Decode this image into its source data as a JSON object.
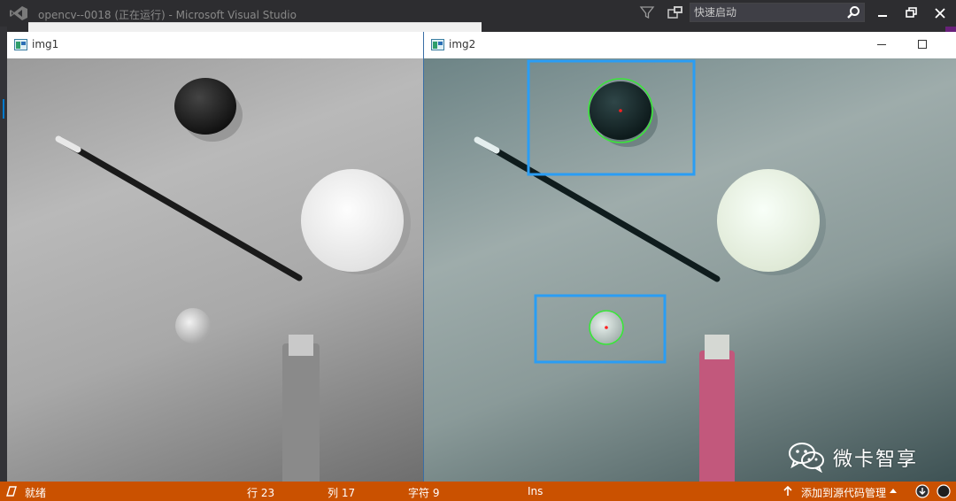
{
  "app": {
    "title": "opencv--0018 (正在运行) - Microsoft Visual Studio",
    "search_placeholder": "快速启动",
    "accent": "#007acc",
    "status_color": "#ca5100"
  },
  "windows": {
    "img1": {
      "title": "img1",
      "mode": "grayscale"
    },
    "img2": {
      "title": "img2",
      "detection_box_color": "#2a9df4",
      "circle_color": "#39e639",
      "center_color": "#ff2020"
    }
  },
  "status_bar": {
    "ready": "就绪",
    "line": "行 23",
    "column": "列 17",
    "char": "字符 9",
    "mode": "Ins",
    "source_control": "添加到源代码管理"
  },
  "watermark": {
    "text": "微卡智享"
  },
  "icons": [
    "vs-logo-icon",
    "filter-icon",
    "feedback-icon",
    "search-icon",
    "minimize-icon",
    "restore-icon",
    "close-icon",
    "window-app-icon",
    "status-bar-icon",
    "arrow-up-icon",
    "caret-up-icon",
    "download-icon",
    "notification-icon",
    "wechat-logo-icon"
  ]
}
